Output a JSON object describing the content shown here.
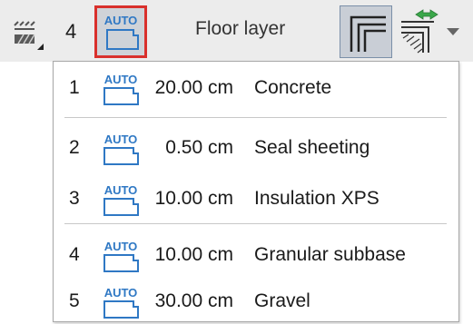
{
  "toolbar": {
    "layer_count": "4",
    "auto_button": {
      "icon": "auto-thickness-icon",
      "label": "AUTO",
      "selected": true
    },
    "floor_label": "Floor layer",
    "corner_button": {
      "icon": "layer-corner-icon",
      "active": true
    },
    "reverse_button": {
      "icon": "reverse-layers-icon"
    },
    "hatch_button": {
      "icon": "hatch-pattern-icon"
    }
  },
  "dropdown": {
    "auto_tag": "AUTO",
    "groups": [
      [
        {
          "index": "1",
          "thickness": "20.00 cm",
          "material": "Concrete"
        }
      ],
      [
        {
          "index": "2",
          "thickness": "0.50 cm",
          "material": "Seal sheeting"
        },
        {
          "index": "3",
          "thickness": "10.00 cm",
          "material": "Insulation XPS"
        }
      ],
      [
        {
          "index": "4",
          "thickness": "10.00 cm",
          "material": "Granular subbase"
        },
        {
          "index": "5",
          "thickness": "30.00 cm",
          "material": "Gravel"
        }
      ]
    ]
  },
  "colors": {
    "accent_blue": "#2f78c4",
    "selection_border": "#d9302c",
    "toolbar_bg": "#ececec",
    "arrow_green": "#3aa84a"
  }
}
